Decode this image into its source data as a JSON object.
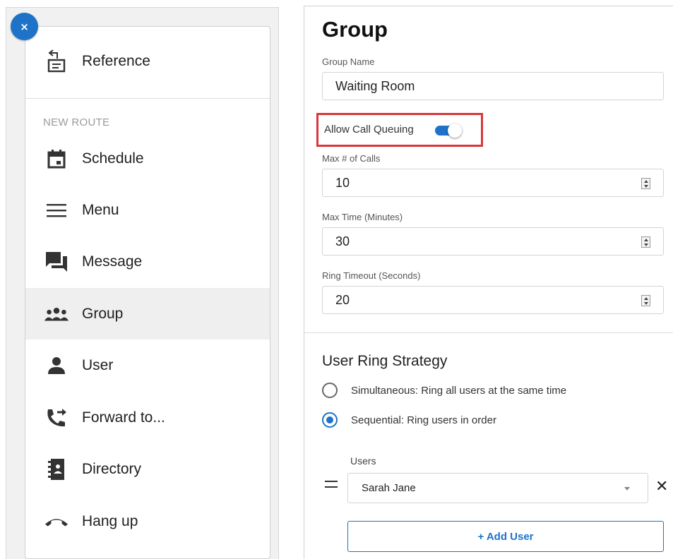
{
  "close_button": {
    "label": "×"
  },
  "sidebar": {
    "reference_label": "Reference",
    "section_label": "NEW ROUTE",
    "items": [
      {
        "label": "Schedule",
        "icon": "calendar-icon"
      },
      {
        "label": "Menu",
        "icon": "menu-icon"
      },
      {
        "label": "Message",
        "icon": "message-icon"
      },
      {
        "label": "Group",
        "icon": "group-icon",
        "active": true
      },
      {
        "label": "User",
        "icon": "user-icon"
      },
      {
        "label": "Forward to...",
        "icon": "forward-call-icon"
      },
      {
        "label": "Directory",
        "icon": "directory-icon"
      },
      {
        "label": "Hang up",
        "icon": "hang-up-icon"
      }
    ]
  },
  "form": {
    "title": "Group",
    "group_name": {
      "label": "Group Name",
      "value": "Waiting Room"
    },
    "allow_call_queuing": {
      "label": "Allow Call Queuing",
      "enabled": true
    },
    "max_calls": {
      "label": "Max # of Calls",
      "value": "10"
    },
    "max_time": {
      "label": "Max Time (Minutes)",
      "value": "30"
    },
    "ring_timeout": {
      "label": "Ring Timeout (Seconds)",
      "value": "20"
    },
    "strategy": {
      "title": "User Ring Strategy",
      "options": [
        {
          "label": "Simultaneous: Ring all users at the same time",
          "selected": false
        },
        {
          "label": "Sequential: Ring users in order",
          "selected": true
        }
      ]
    },
    "users": {
      "label": "Users",
      "selected_user": "Sarah Jane",
      "remove_label": "✕",
      "add_label": "+ Add User"
    }
  },
  "colors": {
    "accent": "#1e73c8",
    "highlight_border": "#d8373a"
  }
}
